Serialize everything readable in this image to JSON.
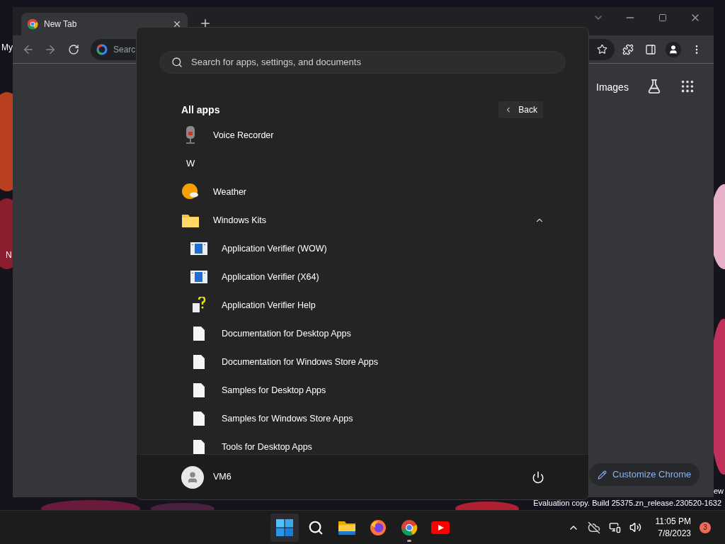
{
  "desktop": {
    "icon_labels": [
      "My",
      "N",
      "ew"
    ],
    "watermark": "Evaluation copy. Build 25375.zn_release.230520-1632"
  },
  "chrome": {
    "tab": {
      "title": "New Tab"
    },
    "address_placeholder": "Searc",
    "header_links": [
      "Images"
    ],
    "customize_button": "Customize Chrome"
  },
  "start_menu": {
    "search_placeholder": "Search for apps, settings, and documents",
    "section_title": "All apps",
    "back_button": "Back",
    "items": [
      {
        "kind": "recorder",
        "label": "Voice Recorder"
      },
      {
        "kind": "letter",
        "label": "W"
      },
      {
        "kind": "weather",
        "label": "Weather"
      },
      {
        "kind": "folder",
        "label": "Windows Kits",
        "expanded": true,
        "children": [
          {
            "kind": "verifier",
            "label": "Application Verifier (WOW)"
          },
          {
            "kind": "verifier",
            "label": "Application Verifier (X64)"
          },
          {
            "kind": "help",
            "label": "Application Verifier Help"
          },
          {
            "kind": "document",
            "label": "Documentation for Desktop Apps"
          },
          {
            "kind": "document",
            "label": "Documentation for Windows Store Apps"
          },
          {
            "kind": "document",
            "label": "Samples for Desktop Apps"
          },
          {
            "kind": "document",
            "label": "Samples for Windows Store Apps"
          },
          {
            "kind": "document",
            "label": "Tools for Desktop Apps"
          }
        ]
      }
    ],
    "user": {
      "name": "VM6"
    }
  },
  "taskbar": {
    "apps": [
      {
        "kind": "start",
        "running": false
      },
      {
        "kind": "search",
        "running": false
      },
      {
        "kind": "explorer",
        "running": false
      },
      {
        "kind": "firefox",
        "running": false
      },
      {
        "kind": "chrome",
        "running": true
      },
      {
        "kind": "youtube",
        "running": false
      }
    ],
    "time": "11:05 PM",
    "date": "7/8/2023",
    "notification_count": "3"
  }
}
